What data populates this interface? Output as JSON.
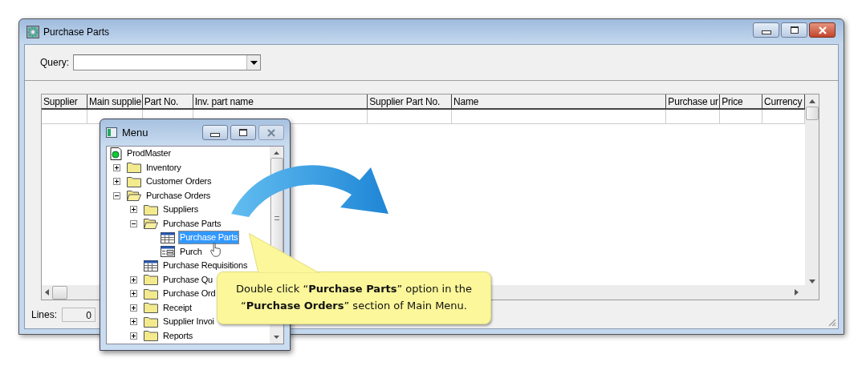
{
  "window": {
    "title": "Purchase Parts"
  },
  "query": {
    "label": "Query:"
  },
  "table": {
    "columns": [
      "Supplier",
      "Main supplie",
      "Part No.",
      "Inv. part name",
      "Supplier Part No.",
      "Name",
      "Purchase ur",
      "Price",
      "Currency"
    ]
  },
  "status_bar": {
    "label": "Lines:",
    "value": "0"
  },
  "menu_window": {
    "title": "Menu",
    "tree": [
      {
        "label": "ProdMaster",
        "kind": "root",
        "selected": false,
        "children": [
          {
            "label": "Inventory",
            "kind": "folder",
            "selected": false,
            "expanded": false
          },
          {
            "label": "Customer Orders",
            "kind": "folder",
            "selected": false,
            "expanded": false
          },
          {
            "label": "Purchase Orders",
            "kind": "folder",
            "selected": false,
            "expanded": true,
            "children": [
              {
                "label": "Suppliers",
                "kind": "folder",
                "selected": false,
                "expanded": false
              },
              {
                "label": "Purchase Parts",
                "kind": "folder",
                "selected": false,
                "expanded": true,
                "children": [
                  {
                    "label": "Purchase Parts",
                    "kind": "table",
                    "selected": true
                  },
                  {
                    "label": "Purch",
                    "kind": "form",
                    "selected": false
                  }
                ]
              },
              {
                "label": "Purchase Requisitions",
                "kind": "table",
                "selected": false
              },
              {
                "label": "Purchase Qu",
                "kind": "folder",
                "selected": false,
                "expanded": false
              },
              {
                "label": "Purchase Ord",
                "kind": "folder",
                "selected": false,
                "expanded": false
              },
              {
                "label": "Receipt",
                "kind": "folder",
                "selected": false,
                "expanded": false
              },
              {
                "label": "Supplier Invoi",
                "kind": "folder",
                "selected": false,
                "expanded": false
              },
              {
                "label": "Reports",
                "kind": "folder",
                "selected": false,
                "expanded": false
              }
            ]
          }
        ]
      }
    ]
  },
  "callout": {
    "text": "Double click “**Purchase Parts**” option in the “**Purchase Orders**” section of Main Menu."
  }
}
